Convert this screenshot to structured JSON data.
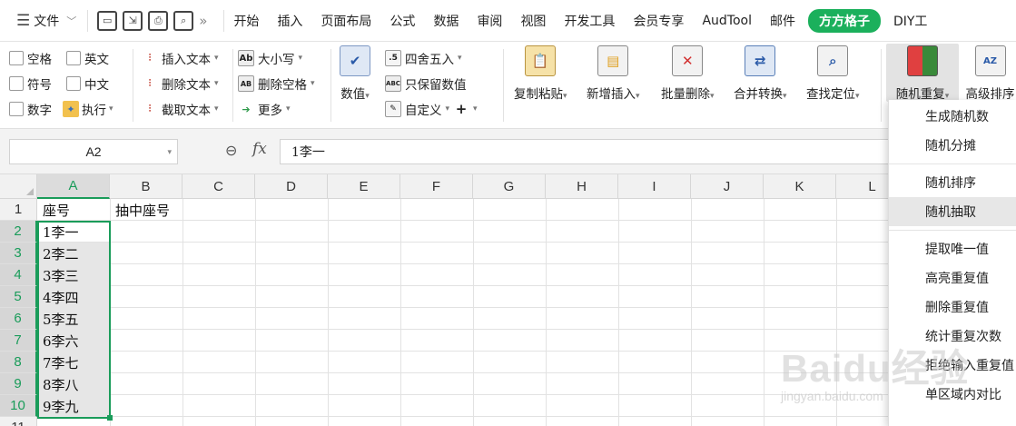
{
  "menubar": {
    "file_label": "文件",
    "tabs": [
      "开始",
      "插入",
      "页面布局",
      "公式",
      "数据",
      "审阅",
      "视图",
      "开发工具",
      "会员专享",
      "AudTool",
      "邮件",
      "方方格子",
      "DIY工"
    ]
  },
  "ribbon": {
    "checkboxes": [
      "空格",
      "英文",
      "符号",
      "中文",
      "数字"
    ],
    "execute": "执行",
    "text_ops": [
      "插入文本",
      "删除文本",
      "截取文本"
    ],
    "case_ops": [
      "大小写",
      "删除空格",
      "更多"
    ],
    "number": "数值",
    "round_ops": [
      "四舍五入",
      "只保留数值",
      "自定义"
    ],
    "big_buttons": [
      "复制粘贴",
      "新增插入",
      "批量删除",
      "合并转换",
      "查找定位",
      "随机重复",
      "高级排序"
    ]
  },
  "formula_bar": {
    "name_box": "A2",
    "fx": "fx",
    "value": "1李一"
  },
  "grid": {
    "columns": [
      "A",
      "B",
      "C",
      "D",
      "E",
      "F",
      "G",
      "H",
      "I",
      "J",
      "K",
      "L"
    ],
    "rows": [
      "1",
      "2",
      "3",
      "4",
      "5",
      "6",
      "7",
      "8",
      "9",
      "10",
      "11"
    ],
    "cells": {
      "A1": "座号",
      "B1": "抽中座号",
      "A2": "1李一",
      "A3": "2李二",
      "A4": "3李三",
      "A5": "4李四",
      "A6": "5李五",
      "A7": "6李六",
      "A8": "7李七",
      "A9": "8李八",
      "A10": "9李九"
    }
  },
  "dropdown": {
    "items": [
      "生成随机数",
      "随机分摊",
      "随机排序",
      "随机抽取",
      "提取唯一值",
      "高亮重复值",
      "删除重复值",
      "统计重复次数",
      "拒绝输入重复值",
      "单区域内对比"
    ]
  },
  "watermark": {
    "brand": "Baidu经验",
    "url": "jingyan.baidu.com"
  }
}
